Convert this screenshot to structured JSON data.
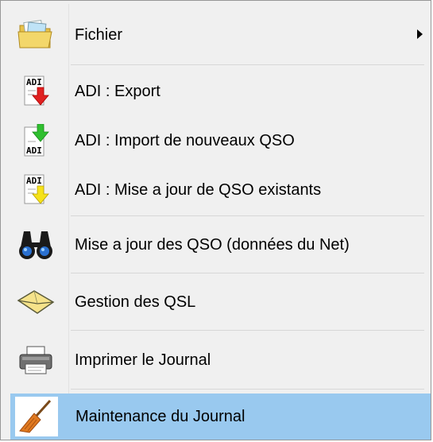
{
  "menu": {
    "items": [
      {
        "label": "Fichier",
        "icon": "folder-icon",
        "has_submenu": true
      },
      {
        "label": "ADI : Export",
        "icon": "adi-export-icon"
      },
      {
        "label": "ADI : Import de nouveaux QSO",
        "icon": "adi-import-icon"
      },
      {
        "label": "ADI : Mise a jour de QSO existants",
        "icon": "adi-update-icon"
      },
      {
        "label": "Mise a jour des QSO (données du Net)",
        "icon": "binoculars-icon"
      },
      {
        "label": "Gestion des QSL",
        "icon": "envelope-icon"
      },
      {
        "label": "Imprimer le Journal",
        "icon": "printer-icon"
      },
      {
        "label": "Maintenance du Journal",
        "icon": "broom-icon",
        "highlighted": true
      }
    ],
    "icon_text": {
      "adi": "ADI"
    },
    "colors": {
      "highlight": "#99c9ef",
      "background": "#f0f0f0"
    }
  }
}
